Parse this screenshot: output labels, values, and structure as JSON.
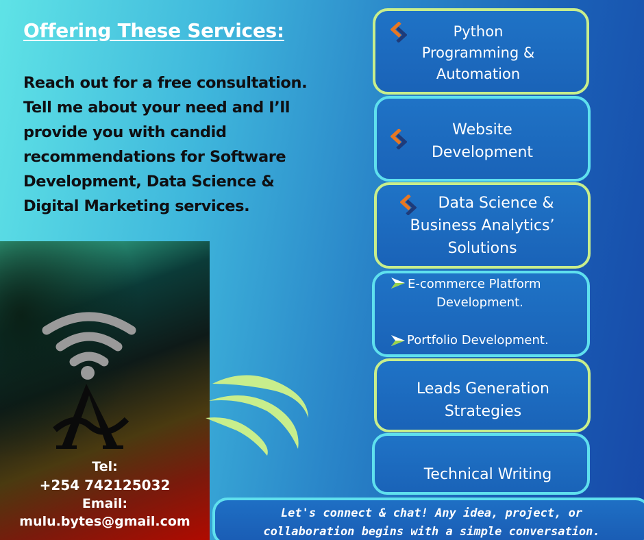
{
  "header": {
    "title": "Offering These Services:",
    "intro": "Reach out for a free consultation. Tell me about your need and I’ll provide you with candid recommendations for Software Development, Data Science & Digital Marketing services."
  },
  "logo": {
    "icon": "wifi-letter-a-logo"
  },
  "contact": {
    "tel_label": "Tel:",
    "tel": "+254 742125032",
    "email_label": "Email:",
    "email": "mulu.bytes@gmail.com"
  },
  "services": [
    {
      "lines": [
        "Python",
        "Programming &",
        "Automation"
      ],
      "icon": "chevron-double-icon"
    },
    {
      "lines": [
        "Website",
        "Development"
      ],
      "icon": "chevron-double-icon"
    },
    {
      "lines": [
        "Data Science &",
        "Business Analytics’",
        "Solutions"
      ],
      "icon": "chevron-double-icon"
    },
    {
      "lines": [
        "E-commerce Platform",
        "Development.",
        "Portfolio Development."
      ],
      "icon": "arrow-bullet-icon"
    },
    {
      "lines": [
        "Leads Generation",
        "Strategies"
      ]
    },
    {
      "lines": [
        "Technical Writing"
      ]
    }
  ],
  "footer": {
    "line1": "Let's connect & chat! Any idea, project, or",
    "line2": "collaboration begins with a simple conversation."
  },
  "colors": {
    "accent_green": "#c8ee8c",
    "accent_cyan": "#5fe0ee",
    "card_blue": "#1a63b8",
    "icon_orange": "#e87722"
  }
}
